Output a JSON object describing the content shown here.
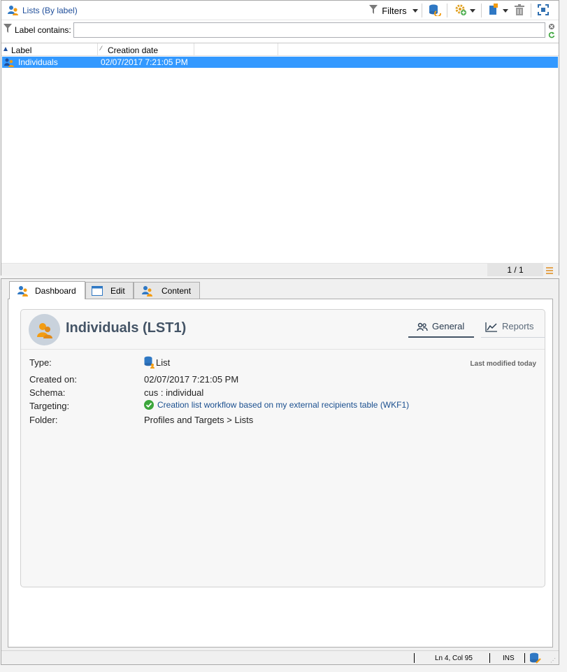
{
  "list_panel": {
    "title": "Lists (By label)",
    "toolbar": {
      "filters_label": "Filters"
    },
    "filter": {
      "label": "Label contains:",
      "value": ""
    },
    "columns": [
      "Label",
      "Creation date"
    ],
    "rows": [
      {
        "label": "Individuals",
        "creation_date": "02/07/2017 7:21:05 PM"
      }
    ],
    "pager": "1 / 1"
  },
  "detail_panel": {
    "tabs": [
      {
        "label": "Dashboard",
        "icon": "people-icon"
      },
      {
        "label": "Edit",
        "icon": "window-icon"
      },
      {
        "label": "Content",
        "icon": "people-icon"
      }
    ],
    "active_tab": "Dashboard",
    "header": {
      "title": "Individuals (LST1)",
      "subtabs": [
        "General",
        "Reports"
      ],
      "active_subtab": "General"
    },
    "last_modified": "Last modified today",
    "fields": [
      {
        "label": "Type:",
        "value": "List"
      },
      {
        "label": "Created on:",
        "value": "02/07/2017 7:21:05 PM"
      },
      {
        "label": "Schema:",
        "value": "cus : individual"
      },
      {
        "label": "Targeting:",
        "value": "Creation list workflow based on my external recipients table (WKF1)"
      },
      {
        "label": "Folder:",
        "value": "Profiles and Targets > Lists"
      }
    ]
  },
  "status_bar": {
    "position": "Ln 4, Col 95",
    "mode": "INS"
  },
  "colors": {
    "selection": "#3399ff",
    "link": "#1a4f8f",
    "title": "#445466",
    "accent_orange": "#f39c12",
    "accent_blue": "#2f78c4"
  }
}
